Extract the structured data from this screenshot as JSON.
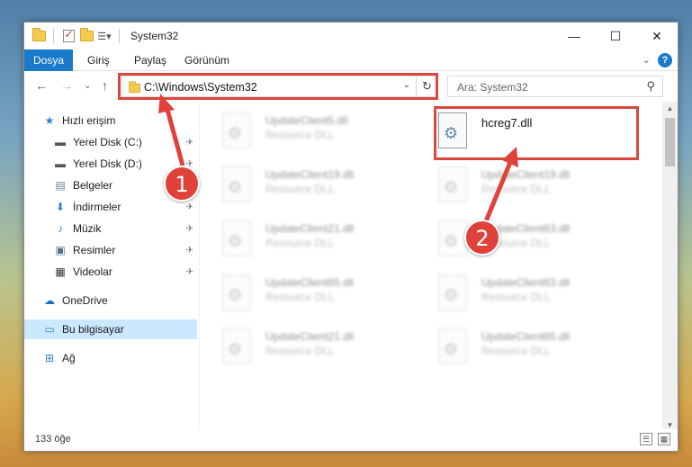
{
  "window": {
    "title": "System32",
    "controls": {
      "minimize": "—",
      "maximize": "☐",
      "close": "✕"
    }
  },
  "ribbon": {
    "tabs": [
      "Dosya",
      "Giriş",
      "Paylaş",
      "Görünüm"
    ],
    "expand": "⌄",
    "help": "?"
  },
  "navigation": {
    "back": "←",
    "forward": "→",
    "recent": "⌄",
    "up": "↑",
    "address": "C:\\Windows\\System32",
    "address_dropdown": "⌄",
    "refresh": "↻",
    "search_placeholder": "Ara: System32",
    "search_icon": "⚲"
  },
  "sidebar": {
    "items": [
      {
        "label": "Hızlı erişim",
        "icon": "star-icon",
        "glyph": "★"
      },
      {
        "label": "Yerel Disk (C:)",
        "icon": "drive-icon",
        "glyph": "▬"
      },
      {
        "label": "Yerel Disk (D:)",
        "icon": "drive-icon",
        "glyph": "▬"
      },
      {
        "label": "Belgeler",
        "icon": "documents-icon",
        "glyph": "▤"
      },
      {
        "label": "İndirmeler",
        "icon": "download-icon",
        "glyph": "⬇"
      },
      {
        "label": "Müzik",
        "icon": "music-icon",
        "glyph": "♪"
      },
      {
        "label": "Resimler",
        "icon": "pictures-icon",
        "glyph": "▣"
      },
      {
        "label": "Videolar",
        "icon": "videos-icon",
        "glyph": "▦"
      },
      {
        "label": "OneDrive",
        "icon": "cloud-icon",
        "glyph": "☁"
      },
      {
        "label": "Bu bilgisayar",
        "icon": "computer-icon",
        "glyph": "▭"
      },
      {
        "label": "Ağ",
        "icon": "network-icon",
        "glyph": "⊞"
      }
    ],
    "pin_glyph": "✈",
    "selected": "Bu bilgisayar"
  },
  "files": [
    {
      "name": "UpdateClient5.dll",
      "type": "Resource DLL"
    },
    {
      "name": "hcreg7.dll",
      "type": ""
    },
    {
      "name": "UpdateClient19.dll",
      "type": "Resource DLL"
    },
    {
      "name": "UpdateClient19.dll",
      "type": "Resource DLL"
    },
    {
      "name": "UpdateClient21.dll",
      "type": "Resource DLL"
    },
    {
      "name": "UpdateClient63.dll",
      "type": "Resource DLL"
    },
    {
      "name": "UpdateClient65.dll",
      "type": "Resource DLL"
    },
    {
      "name": "UpdateClient63.dll",
      "type": "Resource DLL"
    },
    {
      "name": "UpdateClient21.dll",
      "type": "Resource DLL"
    },
    {
      "name": "UpdateClient65.dll",
      "type": "Resource DLL"
    }
  ],
  "status": {
    "item_count": "133 öğe"
  },
  "annotations": {
    "step1": "1",
    "step2": "2",
    "color": "#d9473f"
  }
}
